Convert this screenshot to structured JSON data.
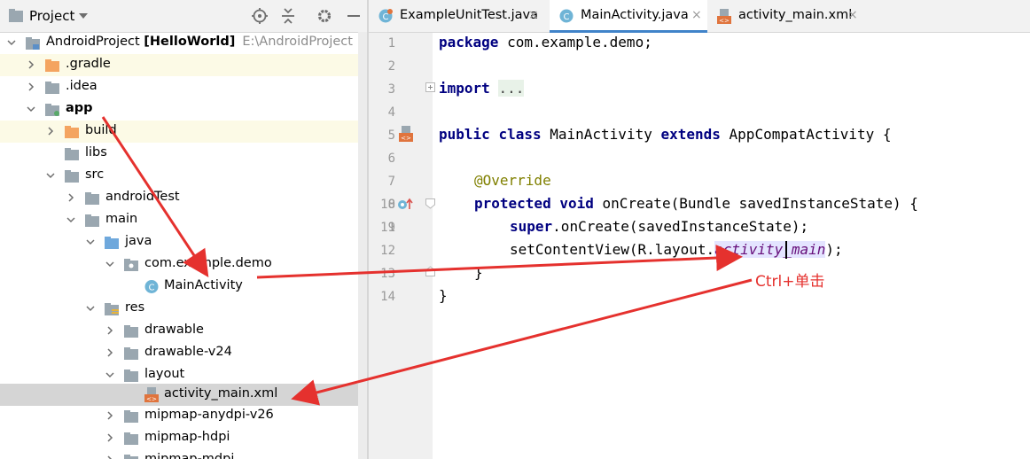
{
  "panel": {
    "title": "Project",
    "icons": [
      "dropdown-arrow-icon",
      "locate-target-icon",
      "collapse-all-icon",
      "gear-icon",
      "minimize-icon"
    ]
  },
  "tree": [
    {
      "label": "AndroidProject",
      "bold_label": "[HelloWorld]",
      "extra": "E:\\AndroidProject",
      "icon": "module-folder-icon"
    },
    {
      "label": ".gradle",
      "icon": "folder-orange-icon"
    },
    {
      "label": ".idea",
      "icon": "folder-icon"
    },
    {
      "label": "app",
      "icon": "module-folder-icon"
    },
    {
      "label": "build",
      "icon": "folder-orange-icon"
    },
    {
      "label": "libs",
      "icon": "folder-icon"
    },
    {
      "label": "src",
      "icon": "folder-icon"
    },
    {
      "label": "androidTest",
      "icon": "folder-icon"
    },
    {
      "label": "main",
      "icon": "folder-icon"
    },
    {
      "label": "java",
      "icon": "source-folder-icon"
    },
    {
      "label": "com.example.demo",
      "icon": "package-icon"
    },
    {
      "label": "MainActivity",
      "icon": "class-icon"
    },
    {
      "label": "res",
      "icon": "resource-folder-icon"
    },
    {
      "label": "drawable",
      "icon": "folder-icon"
    },
    {
      "label": "drawable-v24",
      "icon": "folder-icon"
    },
    {
      "label": "layout",
      "icon": "folder-icon"
    },
    {
      "label": "activity_main.xml",
      "icon": "xml-layout-icon"
    },
    {
      "label": "mipmap-anydpi-v26",
      "icon": "folder-icon"
    },
    {
      "label": "mipmap-hdpi",
      "icon": "folder-icon"
    },
    {
      "label": "mipmap-mdpi",
      "icon": "folder-icon"
    }
  ],
  "tabs": [
    {
      "label": "ExampleUnitTest.java",
      "close": "×",
      "icon": "test-class-icon"
    },
    {
      "label": "MainActivity.java",
      "close": "×",
      "icon": "class-icon"
    },
    {
      "label": "activity_main.xml",
      "close": "×",
      "icon": "xml-layout-icon"
    }
  ],
  "line_numbers": [
    "1",
    "2",
    "3",
    "4",
    "5",
    "6",
    "7",
    "8",
    "9",
    "10",
    "11",
    "12",
    "13",
    "14"
  ],
  "code": {
    "l1_kw": "package",
    "l1_rest": " com.example.demo;",
    "l3_kw": "import",
    "l3_fold": "...",
    "l7_kw1": "public",
    "l7_kw2": "class",
    "l7_name": " MainActivity ",
    "l7_kw3": "extends",
    "l7_rest": " AppCompatActivity {",
    "l9": "@Override",
    "l10_kw1": "protected",
    "l10_kw2": "void",
    "l10_rest": " onCreate(Bundle savedInstanceState) {",
    "l11_kw": "super",
    "l11_rest": ".onCreate(savedInstanceState);",
    "l12_pre": "setContentView(R.layout.",
    "l12_field": "activity_main",
    "l12_post": ");",
    "l13": "}",
    "l14": "}"
  },
  "annotation": "Ctrl+单击",
  "colors": {
    "arrow": "#e5312e",
    "keyword": "#000080",
    "annotation": "#808000",
    "field": "#660e7a",
    "tab_accent": "#4083c9"
  }
}
